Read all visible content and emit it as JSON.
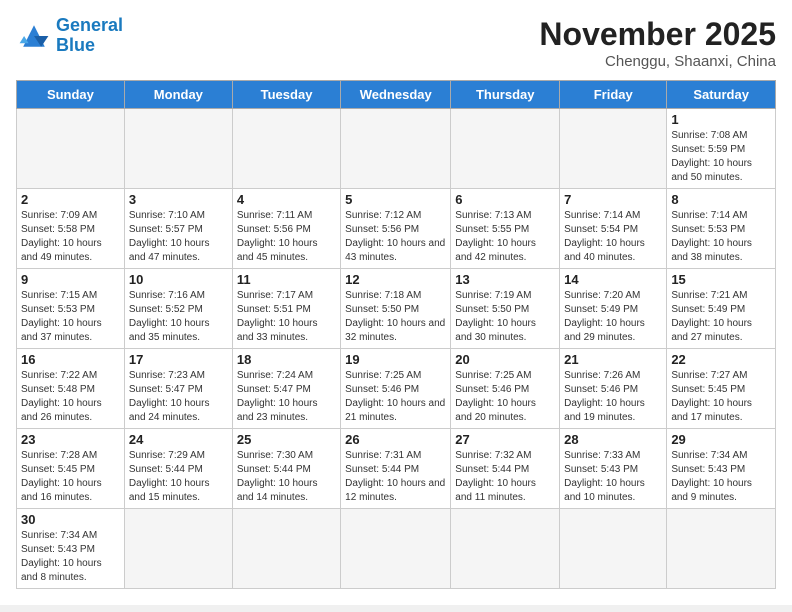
{
  "logo": {
    "general": "General",
    "blue": "Blue"
  },
  "title": "November 2025",
  "location": "Chenggu, Shaanxi, China",
  "weekdays": [
    "Sunday",
    "Monday",
    "Tuesday",
    "Wednesday",
    "Thursday",
    "Friday",
    "Saturday"
  ],
  "days": [
    {
      "num": "",
      "sunrise": "",
      "sunset": "",
      "daylight": "",
      "empty": true
    },
    {
      "num": "",
      "sunrise": "",
      "sunset": "",
      "daylight": "",
      "empty": true
    },
    {
      "num": "",
      "sunrise": "",
      "sunset": "",
      "daylight": "",
      "empty": true
    },
    {
      "num": "",
      "sunrise": "",
      "sunset": "",
      "daylight": "",
      "empty": true
    },
    {
      "num": "",
      "sunrise": "",
      "sunset": "",
      "daylight": "",
      "empty": true
    },
    {
      "num": "",
      "sunrise": "",
      "sunset": "",
      "daylight": "",
      "empty": true
    },
    {
      "num": "1",
      "sunrise": "Sunrise: 7:08 AM",
      "sunset": "Sunset: 5:59 PM",
      "daylight": "Daylight: 10 hours and 50 minutes.",
      "empty": false
    },
    {
      "num": "2",
      "sunrise": "Sunrise: 7:09 AM",
      "sunset": "Sunset: 5:58 PM",
      "daylight": "Daylight: 10 hours and 49 minutes.",
      "empty": false
    },
    {
      "num": "3",
      "sunrise": "Sunrise: 7:10 AM",
      "sunset": "Sunset: 5:57 PM",
      "daylight": "Daylight: 10 hours and 47 minutes.",
      "empty": false
    },
    {
      "num": "4",
      "sunrise": "Sunrise: 7:11 AM",
      "sunset": "Sunset: 5:56 PM",
      "daylight": "Daylight: 10 hours and 45 minutes.",
      "empty": false
    },
    {
      "num": "5",
      "sunrise": "Sunrise: 7:12 AM",
      "sunset": "Sunset: 5:56 PM",
      "daylight": "Daylight: 10 hours and 43 minutes.",
      "empty": false
    },
    {
      "num": "6",
      "sunrise": "Sunrise: 7:13 AM",
      "sunset": "Sunset: 5:55 PM",
      "daylight": "Daylight: 10 hours and 42 minutes.",
      "empty": false
    },
    {
      "num": "7",
      "sunrise": "Sunrise: 7:14 AM",
      "sunset": "Sunset: 5:54 PM",
      "daylight": "Daylight: 10 hours and 40 minutes.",
      "empty": false
    },
    {
      "num": "8",
      "sunrise": "Sunrise: 7:14 AM",
      "sunset": "Sunset: 5:53 PM",
      "daylight": "Daylight: 10 hours and 38 minutes.",
      "empty": false
    },
    {
      "num": "9",
      "sunrise": "Sunrise: 7:15 AM",
      "sunset": "Sunset: 5:53 PM",
      "daylight": "Daylight: 10 hours and 37 minutes.",
      "empty": false
    },
    {
      "num": "10",
      "sunrise": "Sunrise: 7:16 AM",
      "sunset": "Sunset: 5:52 PM",
      "daylight": "Daylight: 10 hours and 35 minutes.",
      "empty": false
    },
    {
      "num": "11",
      "sunrise": "Sunrise: 7:17 AM",
      "sunset": "Sunset: 5:51 PM",
      "daylight": "Daylight: 10 hours and 33 minutes.",
      "empty": false
    },
    {
      "num": "12",
      "sunrise": "Sunrise: 7:18 AM",
      "sunset": "Sunset: 5:50 PM",
      "daylight": "Daylight: 10 hours and 32 minutes.",
      "empty": false
    },
    {
      "num": "13",
      "sunrise": "Sunrise: 7:19 AM",
      "sunset": "Sunset: 5:50 PM",
      "daylight": "Daylight: 10 hours and 30 minutes.",
      "empty": false
    },
    {
      "num": "14",
      "sunrise": "Sunrise: 7:20 AM",
      "sunset": "Sunset: 5:49 PM",
      "daylight": "Daylight: 10 hours and 29 minutes.",
      "empty": false
    },
    {
      "num": "15",
      "sunrise": "Sunrise: 7:21 AM",
      "sunset": "Sunset: 5:49 PM",
      "daylight": "Daylight: 10 hours and 27 minutes.",
      "empty": false
    },
    {
      "num": "16",
      "sunrise": "Sunrise: 7:22 AM",
      "sunset": "Sunset: 5:48 PM",
      "daylight": "Daylight: 10 hours and 26 minutes.",
      "empty": false
    },
    {
      "num": "17",
      "sunrise": "Sunrise: 7:23 AM",
      "sunset": "Sunset: 5:47 PM",
      "daylight": "Daylight: 10 hours and 24 minutes.",
      "empty": false
    },
    {
      "num": "18",
      "sunrise": "Sunrise: 7:24 AM",
      "sunset": "Sunset: 5:47 PM",
      "daylight": "Daylight: 10 hours and 23 minutes.",
      "empty": false
    },
    {
      "num": "19",
      "sunrise": "Sunrise: 7:25 AM",
      "sunset": "Sunset: 5:46 PM",
      "daylight": "Daylight: 10 hours and 21 minutes.",
      "empty": false
    },
    {
      "num": "20",
      "sunrise": "Sunrise: 7:25 AM",
      "sunset": "Sunset: 5:46 PM",
      "daylight": "Daylight: 10 hours and 20 minutes.",
      "empty": false
    },
    {
      "num": "21",
      "sunrise": "Sunrise: 7:26 AM",
      "sunset": "Sunset: 5:46 PM",
      "daylight": "Daylight: 10 hours and 19 minutes.",
      "empty": false
    },
    {
      "num": "22",
      "sunrise": "Sunrise: 7:27 AM",
      "sunset": "Sunset: 5:45 PM",
      "daylight": "Daylight: 10 hours and 17 minutes.",
      "empty": false
    },
    {
      "num": "23",
      "sunrise": "Sunrise: 7:28 AM",
      "sunset": "Sunset: 5:45 PM",
      "daylight": "Daylight: 10 hours and 16 minutes.",
      "empty": false
    },
    {
      "num": "24",
      "sunrise": "Sunrise: 7:29 AM",
      "sunset": "Sunset: 5:44 PM",
      "daylight": "Daylight: 10 hours and 15 minutes.",
      "empty": false
    },
    {
      "num": "25",
      "sunrise": "Sunrise: 7:30 AM",
      "sunset": "Sunset: 5:44 PM",
      "daylight": "Daylight: 10 hours and 14 minutes.",
      "empty": false
    },
    {
      "num": "26",
      "sunrise": "Sunrise: 7:31 AM",
      "sunset": "Sunset: 5:44 PM",
      "daylight": "Daylight: 10 hours and 12 minutes.",
      "empty": false
    },
    {
      "num": "27",
      "sunrise": "Sunrise: 7:32 AM",
      "sunset": "Sunset: 5:44 PM",
      "daylight": "Daylight: 10 hours and 11 minutes.",
      "empty": false
    },
    {
      "num": "28",
      "sunrise": "Sunrise: 7:33 AM",
      "sunset": "Sunset: 5:43 PM",
      "daylight": "Daylight: 10 hours and 10 minutes.",
      "empty": false
    },
    {
      "num": "29",
      "sunrise": "Sunrise: 7:34 AM",
      "sunset": "Sunset: 5:43 PM",
      "daylight": "Daylight: 10 hours and 9 minutes.",
      "empty": false
    },
    {
      "num": "30",
      "sunrise": "Sunrise: 7:34 AM",
      "sunset": "Sunset: 5:43 PM",
      "daylight": "Daylight: 10 hours and 8 minutes.",
      "empty": false
    }
  ]
}
